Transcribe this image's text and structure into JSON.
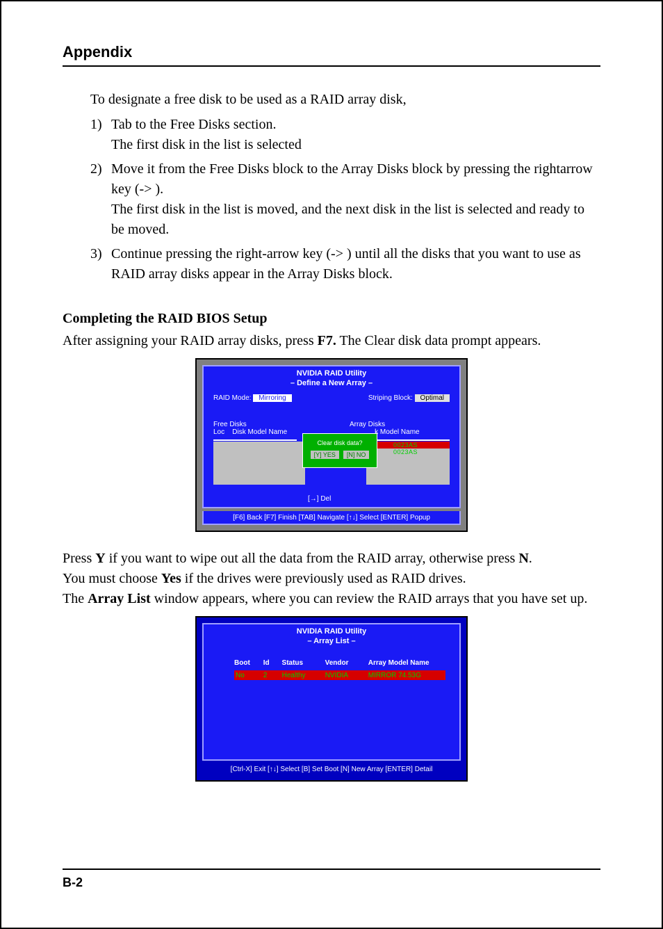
{
  "header": {
    "title": "Appendix"
  },
  "intro": "To designate a free disk to be used as a RAID array disk,",
  "steps": [
    {
      "num": "1)",
      "line1": "Tab to the Free Disks section.",
      "line2": "The first disk in the list is selected"
    },
    {
      "num": "2)",
      "line1": "Move it from the Free Disks block to the Array Disks block by pressing the rightarrow key (-> ).",
      "line2": "The first disk in the list is moved, and the next disk in the list is selected and ready to be moved."
    },
    {
      "num": "3)",
      "line1": "Continue pressing the right-arrow key (-> ) until all the disks that you want to use as RAID array disks appear in the Array Disks block.",
      "line2": ""
    }
  ],
  "subheading1": "Completing the RAID BIOS Setup",
  "para1_pre": "After assigning your RAID array disks, press ",
  "para1_key": "F7.",
  "para1_post": "  The Clear disk data prompt appears.",
  "bios1": {
    "title1": "NVIDIA RAID Utility",
    "title2": "–  Define a New Array  –",
    "raid_mode_label": "RAID Mode:",
    "raid_mode_value": "Mirroring",
    "striping_label": "Striping Block:",
    "striping_value": "Optimal",
    "free_disks_label": "Free Disks",
    "loc_label": "Loc",
    "disk_model_label": "Disk Model Name",
    "array_disks_label": "Array Disks",
    "model_name_label": "k Model Name",
    "model_txt1": "0023AS",
    "model_txt2": "0023AS",
    "dialog_q": "Clear disk data?",
    "dialog_yes": "[Y] YES",
    "dialog_no": "[N] NO",
    "del_label": "[→] Del",
    "footer": "[F6] Back  [F7] Finish  [TAB] Navigate  [↑↓] Select  [ENTER] Popup"
  },
  "para2_pre": "Press ",
  "para2_y": "Y",
  "para2_mid": " if you want to wipe out all the data from the RAID array, otherwise press ",
  "para2_n": "N",
  "para2_end": ".",
  "para3_pre": "You must choose ",
  "para3_yes": "Yes",
  "para3_post": " if the drives were previously used as RAID drives.",
  "para4_pre": "The ",
  "para4_al": "Array List",
  "para4_post": " window appears, where you can review the RAID arrays that you have set up.",
  "bios2": {
    "title1": "NVIDIA RAID Utility",
    "title2": "–  Array  List –",
    "headers": {
      "boot": "Boot",
      "id": "Id",
      "status": "Status",
      "vendor": "Vendor",
      "model": "Array Model Name"
    },
    "row": {
      "boot": "No",
      "id": "2",
      "status": "Healthy",
      "vendor": "NVIDIA",
      "model": "MIRROR   74.53G"
    },
    "footer": "[Ctrl-X] Exit  [↑↓] Select  [B] Set Boot  [N] New Array  [ENTER] Detail"
  },
  "page_number": "B-2"
}
